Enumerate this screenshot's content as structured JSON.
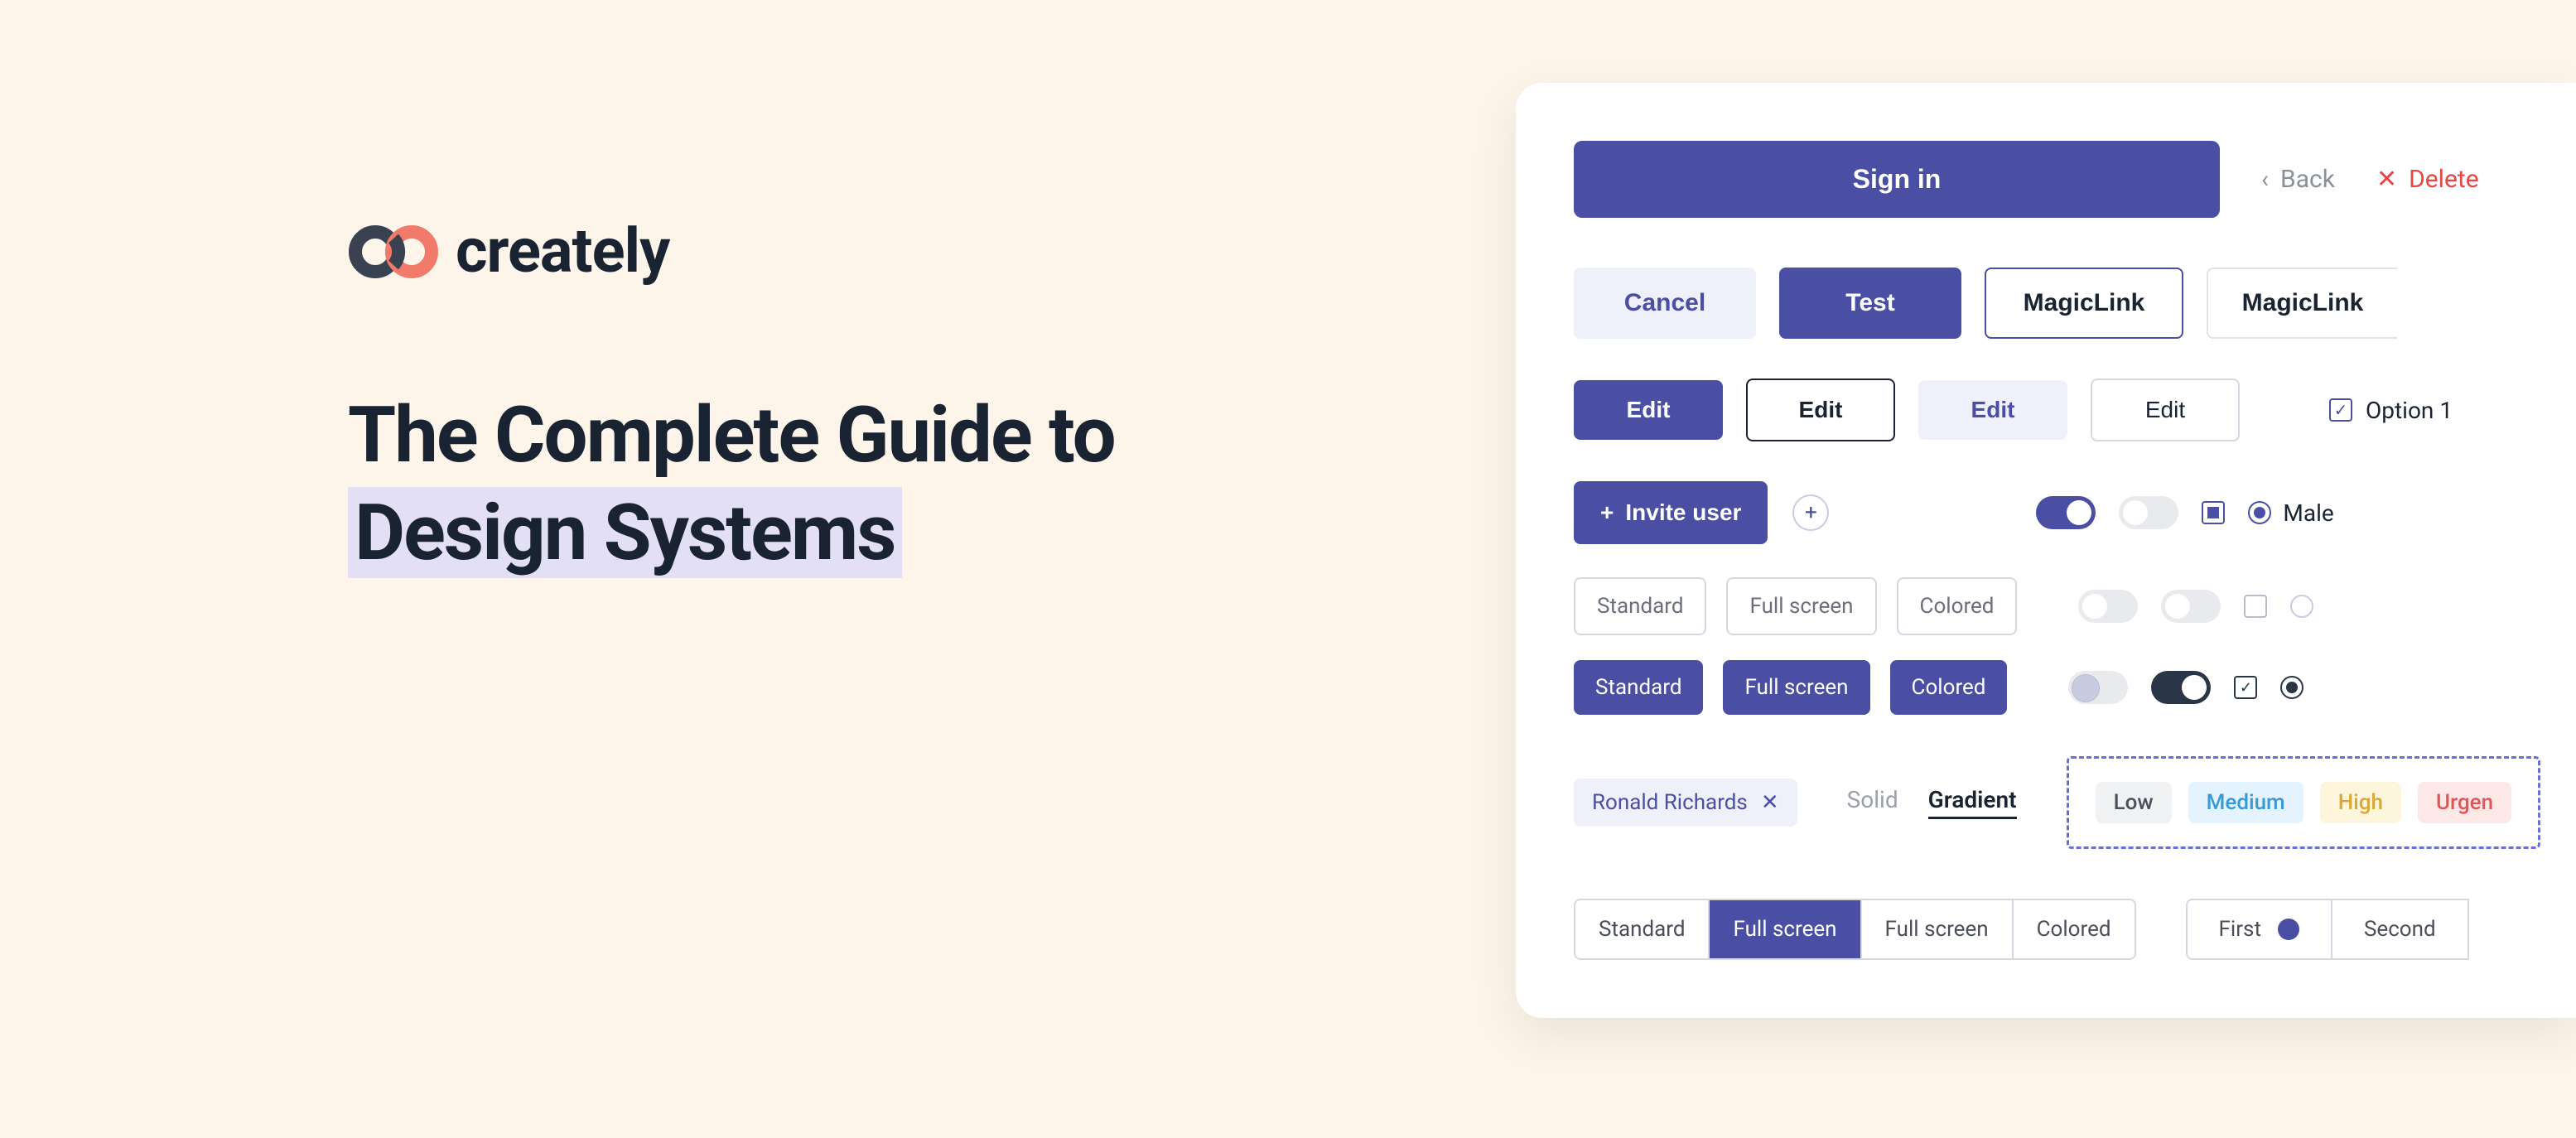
{
  "brand": {
    "name": "creately"
  },
  "headline": {
    "line1": "The Complete Guide to",
    "highlight": "Design Systems"
  },
  "card": {
    "signin": "Sign in",
    "back": "Back",
    "delete": "Delete",
    "cancel": "Cancel",
    "test": "Test",
    "magiclink1": "MagicLink",
    "magiclink2": "MagicLink",
    "edit1": "Edit",
    "edit2": "Edit",
    "edit3": "Edit",
    "edit4": "Edit",
    "option1": "Option 1",
    "invite": "Invite user",
    "male": "Male",
    "segA": {
      "standard": "Standard",
      "fullscreen": "Full screen",
      "colored": "Colored"
    },
    "segB": {
      "standard": "Standard",
      "fullscreen": "Full screen",
      "colored": "Colored"
    },
    "chip": "Ronald Richards",
    "tabs": {
      "solid": "Solid",
      "gradient": "Gradient"
    },
    "tags": {
      "low": "Low",
      "medium": "Medium",
      "high": "High",
      "urgent": "Urgen"
    },
    "segC": {
      "standard": "Standard",
      "fullscreen1": "Full screen",
      "fullscreen2": "Full screen",
      "colored": "Colored"
    },
    "steps": {
      "first": "First",
      "second": "Second"
    }
  }
}
